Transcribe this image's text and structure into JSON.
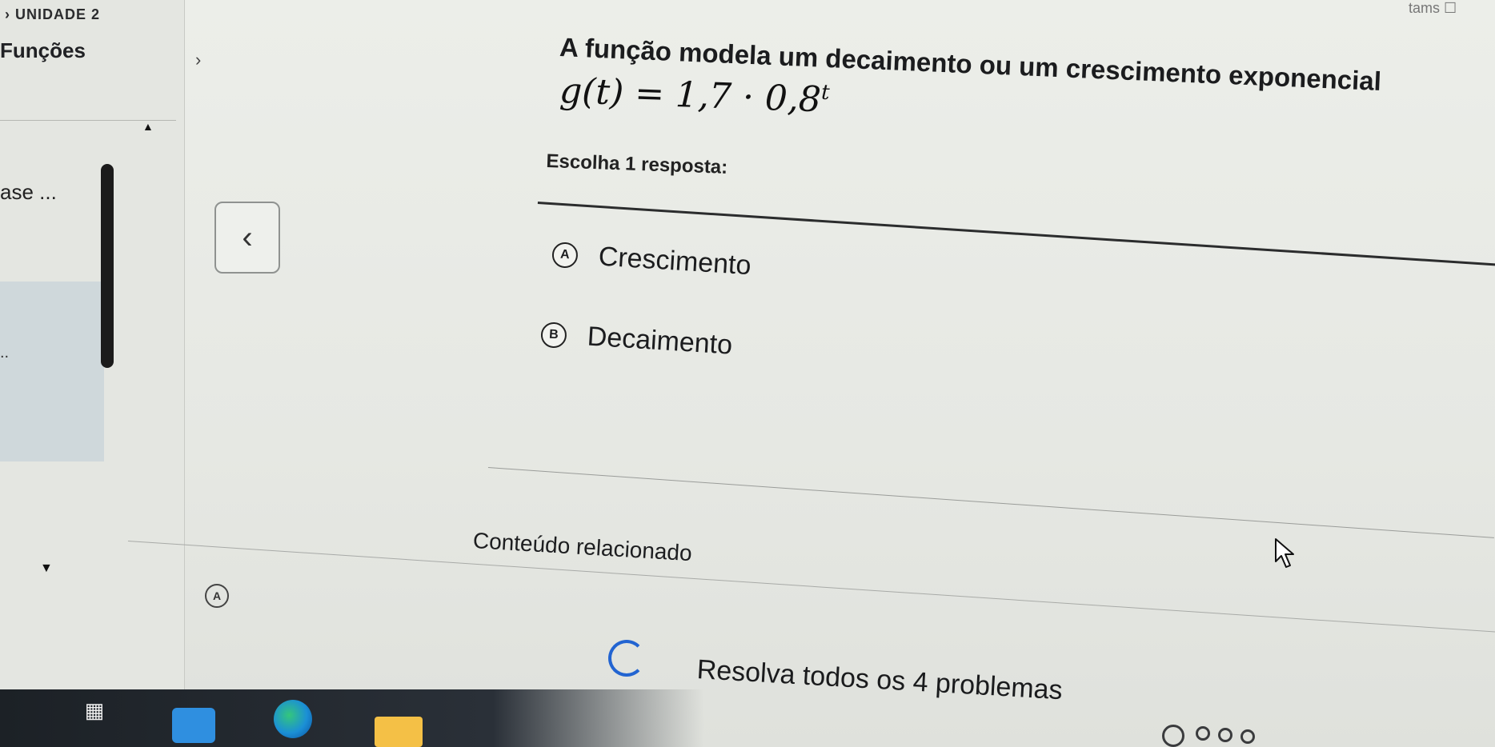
{
  "sidebar": {
    "unit_label": "› UNIDADE 2",
    "unit_title": "Funções",
    "unit_chevron": "›",
    "item_fragment": "ase ...",
    "selected_item_fragment": ".."
  },
  "nav": {
    "prev_glyph": "‹"
  },
  "question": {
    "prompt": "A função modela um decaimento ou um crescimento exponencial",
    "formula_lhs": "g(t) = 1,7 · 0,8",
    "formula_exp": "t",
    "choose_label": "Escolha 1 resposta:",
    "options": [
      {
        "letter": "A",
        "text": "Crescimento"
      },
      {
        "letter": "B",
        "text": "Decaimento"
      }
    ]
  },
  "related": {
    "label": "Conteúdo relacionado",
    "toggle_letter": "A"
  },
  "footer": {
    "solve_all_label": "Resolva todos os 4 problemas",
    "progress_total": 4
  },
  "top_right_fragment": "tams ☐",
  "taskbar": {
    "icons": [
      "task-view-icon",
      "store-icon",
      "edge-icon",
      "file-explorer-icon"
    ]
  },
  "colors": {
    "accent": "#2264d1",
    "background": "#e9ebe7",
    "text": "#1b1c1e",
    "selected_sidebar": "#cfd8db"
  }
}
